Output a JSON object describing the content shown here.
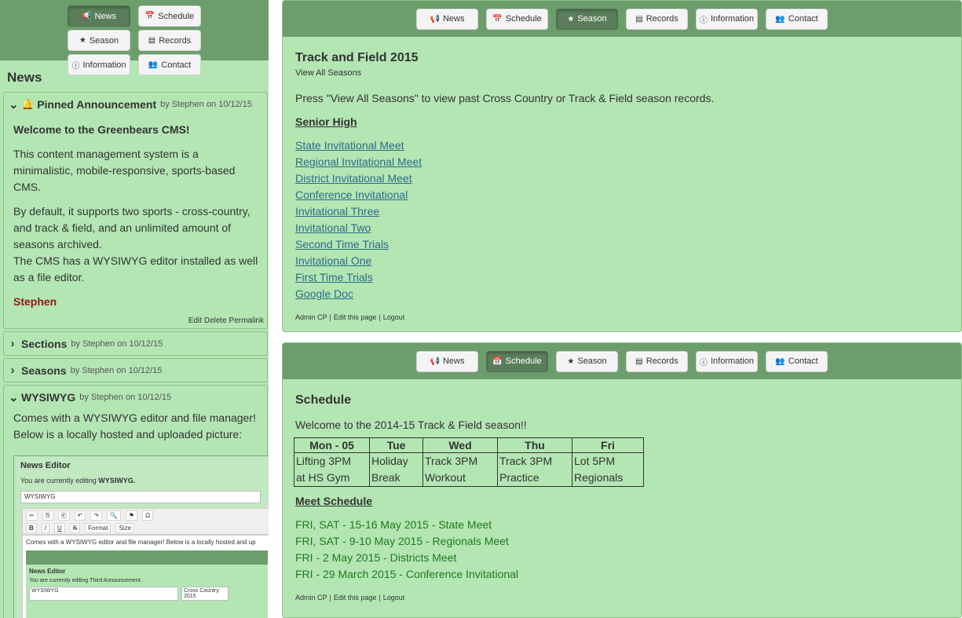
{
  "left": {
    "nav": [
      {
        "label": "News",
        "icon": "megaphone-icon",
        "active": true
      },
      {
        "label": "Schedule",
        "icon": "calendar-icon",
        "active": false
      },
      {
        "label": "Season",
        "icon": "star-icon",
        "active": false
      },
      {
        "label": "Records",
        "icon": "list-icon",
        "active": false
      },
      {
        "label": "Information",
        "icon": "info-icon",
        "active": false
      },
      {
        "label": "Contact",
        "icon": "users-icon",
        "active": false
      }
    ],
    "heading": "News",
    "pinned": {
      "title": "Pinned Announcement",
      "meta": "by Stephen on 10/12/15",
      "welcome": "Welcome to the Greenbears CMS!",
      "p1": "This content management system is a minimalistic, mobile-responsive, sports-based CMS.",
      "p2a": "By default, it supports two sports - cross-country, and track & field, and an unlimited amount of seasons archived.",
      "p2b": "The CMS has a WYSIWYG editor installed as well as a file editor.",
      "author": "Stephen",
      "actions": {
        "edit": "Edit",
        "delete": "Delete",
        "permalink": "Permalink"
      }
    },
    "sections": {
      "title": "Sections",
      "meta": "by Stephen on 10/12/15"
    },
    "seasons": {
      "title": "Seasons",
      "meta": "by Stephen on 10/12/15"
    },
    "wysiwyg": {
      "title": "WYSIWYG",
      "meta": "by Stephen on 10/12/15",
      "text": "Comes with a WYSIWYG editor and file manager! Below is a locally hosted and uploaded picture:"
    },
    "editor": {
      "heading": "News Editor",
      "sub_prefix": "You are currently editing",
      "sub_target": "WYSIWYG.",
      "input_value": "WYSIWYG",
      "toolbar_format": "Format",
      "toolbar_size": "Size",
      "content": "Comes with a WYSIWYG editor and file manager! Below is a locally hosted and up",
      "inner_heading": "News Editor",
      "inner_sub": "You are currently editing Third Announcement.",
      "inner_input": "WYSIWYG",
      "inner_select": "Cross Country 2015"
    }
  },
  "season_panel": {
    "nav": [
      {
        "label": "News",
        "icon": "megaphone-icon",
        "active": false
      },
      {
        "label": "Schedule",
        "icon": "calendar-icon",
        "active": false
      },
      {
        "label": "Season",
        "icon": "star-icon",
        "active": true
      },
      {
        "label": "Records",
        "icon": "list-icon",
        "active": false
      },
      {
        "label": "Information",
        "icon": "info-icon",
        "active": false
      },
      {
        "label": "Contact",
        "icon": "users-icon",
        "active": false
      }
    ],
    "title": "Track and Field 2015",
    "view_all": "View All Seasons",
    "intro": "Press \"View All Seasons\" to view past Cross Country or Track & Field season records.",
    "section": "Senior High",
    "meets": [
      "State Invitational Meet ",
      "Regional Invitational Meet",
      "District Invitational Meet",
      "Conference Invitational",
      "Invitational Three",
      "Invitational Two",
      "Second Time Trials",
      "Invitational One",
      "First Time Trials",
      "Google Doc"
    ],
    "admin": {
      "cp": "Admin CP",
      "edit": "Edit this page",
      "logout": "Logout",
      "sep": "|"
    }
  },
  "schedule_panel": {
    "nav": [
      {
        "label": "News",
        "icon": "megaphone-icon",
        "active": false
      },
      {
        "label": "Schedule",
        "icon": "calendar-icon",
        "active": true
      },
      {
        "label": "Season",
        "icon": "star-icon",
        "active": false
      },
      {
        "label": "Records",
        "icon": "list-icon",
        "active": false
      },
      {
        "label": "Information",
        "icon": "info-icon",
        "active": false
      },
      {
        "label": "Contact",
        "icon": "users-icon",
        "active": false
      }
    ],
    "title": "Schedule",
    "welcome": "Welcome to the 2014-15 Track & Field season!!",
    "table": {
      "headers": [
        "Mon - 05",
        "Tue",
        "Wed",
        "Thu",
        "Fri"
      ],
      "rows": [
        [
          "Lifting 3PM",
          "Holiday",
          "Track 3PM",
          "Track 3PM",
          "Lot 5PM"
        ],
        [
          "at HS Gym",
          "Break",
          "Workout",
          "Practice",
          "Regionals"
        ]
      ]
    },
    "meet_heading": "Meet Schedule",
    "meets": [
      "FRI, SAT - 15-16 May 2015 - State Meet",
      "FRI, SAT - 9-10 May 2015 - Regionals Meet",
      "FRI - 2 May 2015 - Districts Meet",
      "FRI - 29 March 2015 - Conference Invitational"
    ],
    "admin": {
      "cp": "Admin CP",
      "edit": "Edit this page",
      "logout": "Logout",
      "sep": "|"
    }
  },
  "colors": {
    "nav_bg": "#6c9e6c",
    "panel_bg": "#b3e6b3",
    "active_btn": "#5a7e5a",
    "link": "#2e6b8a",
    "author": "#8b1a1a",
    "meet_link": "#1f7a1f"
  }
}
